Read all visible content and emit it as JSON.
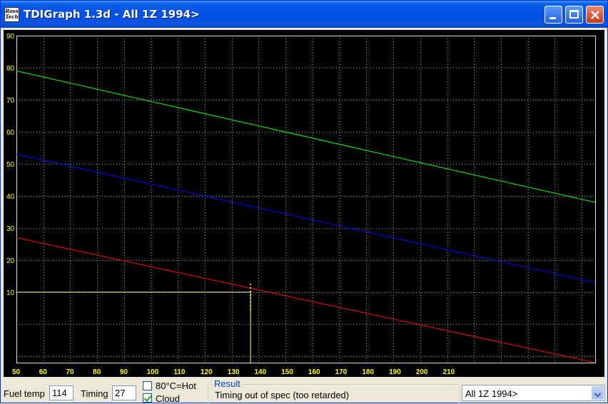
{
  "window": {
    "title": "TDIGraph 1.3d - All 1Z 1994>",
    "icon_text_1": "Ross",
    "icon_text_2": "Tech"
  },
  "chart_data": {
    "type": "line",
    "x_ticks": [
      50,
      60,
      70,
      80,
      90,
      100,
      110,
      120,
      130,
      140,
      150,
      160,
      170,
      180,
      190,
      200,
      210
    ],
    "y_ticks": [
      10,
      20,
      30,
      40,
      50,
      60,
      70,
      80,
      90
    ],
    "xlim": [
      50,
      265
    ],
    "ylim": [
      -12,
      90
    ],
    "grid": true,
    "background": "#000000",
    "series": [
      {
        "color": "#00ff00",
        "x": [
          50,
          265
        ],
        "y": [
          79,
          38
        ]
      },
      {
        "color": "#0000ff",
        "x": [
          50,
          265
        ],
        "y": [
          53,
          13
        ]
      },
      {
        "color": "#ff0000",
        "x": [
          50,
          265
        ],
        "y": [
          27,
          -12
        ]
      }
    ],
    "marker": {
      "color": "#ffff80",
      "x": 137,
      "y": 10
    }
  },
  "controls": {
    "fuel_temp_label": "Fuel temp",
    "fuel_temp_value": "114",
    "timing_label": "Timing",
    "timing_value": "27",
    "hot_label": "80°C=Hot",
    "hot_checked": false,
    "cloud_label": "Cloud",
    "cloud_checked": true,
    "result_legend": "Result",
    "result_text": "Timing out of spec (too retarded)",
    "engine_select": "All 1Z 1994>"
  }
}
